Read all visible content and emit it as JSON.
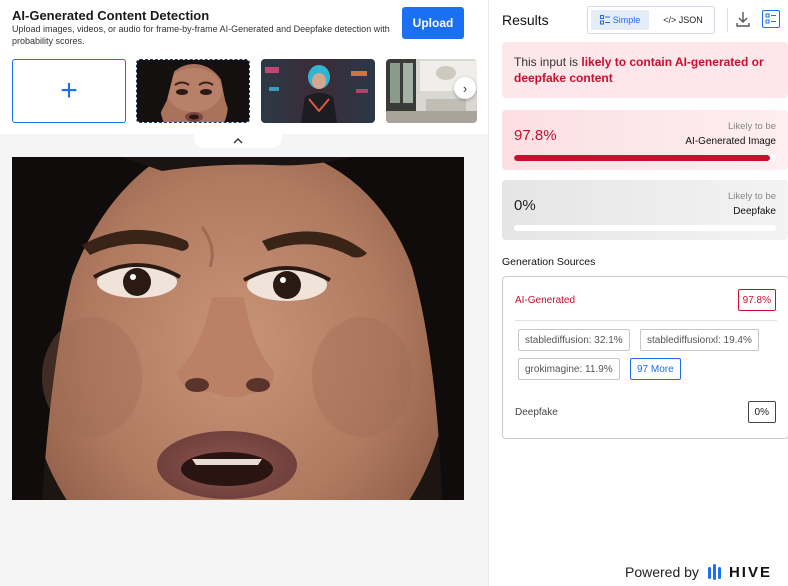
{
  "app": {
    "title": "AI-Generated Content Detection",
    "subtitle": "Upload images, videos, or audio for frame-by-frame AI-Generated and Deepfake detection with probability scores.",
    "upload_label": "Upload"
  },
  "icons": {
    "add": "plus-icon",
    "next": "chevron-right-icon",
    "collapse": "chevron-up-icon",
    "download": "download-icon",
    "view": "list-view-icon",
    "simple": "simple-view-icon",
    "json": "code-icon",
    "brand": "hive-logo-icon"
  },
  "thumbs": {
    "add_glyph": "+",
    "next_glyph": "›",
    "collapse_glyph": "˄"
  },
  "results": {
    "title": "Results",
    "view_simple": "Simple",
    "view_json": "</> JSON",
    "verdict_prefix": "This input is ",
    "verdict_highlight": "likely to contain AI-generated or deepfake content",
    "ai_score": {
      "percent": "97.8%",
      "value": 0.978,
      "likely": "Likely to be",
      "label": "AI-Generated Image"
    },
    "deepfake_score": {
      "percent": "0%",
      "value": 0,
      "likely": "Likely to be",
      "label": "Deepfake"
    },
    "gen_sources_title": "Generation Sources",
    "ai_label": "AI-Generated",
    "ai_badge": "97.8%",
    "sources": [
      "stablediffusion: 32.1%",
      "stablediffusionxl: 19.4%",
      "grokimagine: 11.9%"
    ],
    "more_label": "97 More",
    "deepfake_label": "Deepfake",
    "deepfake_badge": "0%"
  },
  "footer": {
    "powered_by": "Powered by",
    "brand": "HIVE"
  },
  "colors": {
    "accent": "#1a6ff3",
    "alert": "#c8102e",
    "alert_bg": "#fde7ea"
  }
}
